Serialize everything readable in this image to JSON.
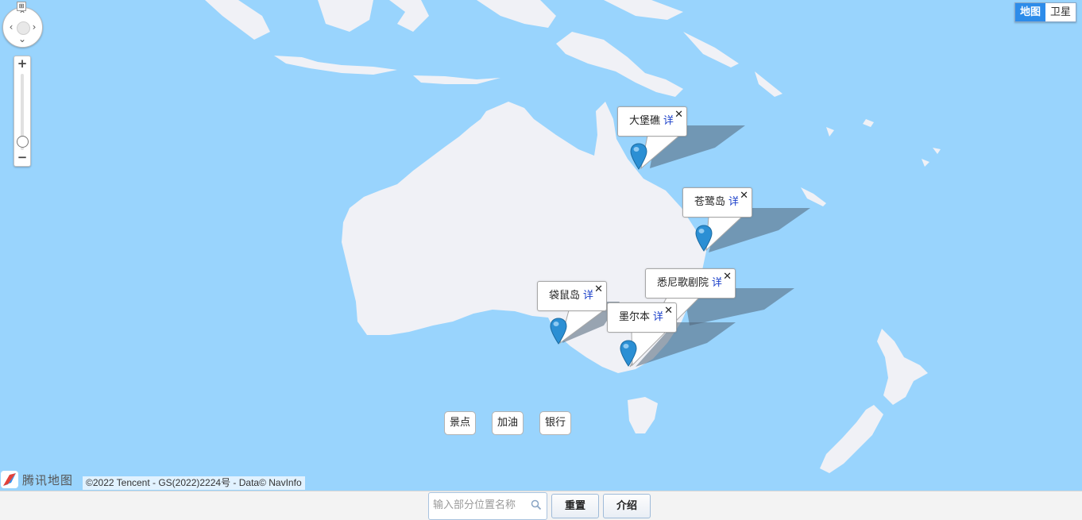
{
  "map": {
    "nav_badge": "⊞",
    "zoom_in_label": "+",
    "zoom_out_label": "−",
    "map_type": {
      "map_label": "地图",
      "satellite_label": "卫星",
      "active": "map"
    },
    "info_windows": [
      {
        "name": "大堡礁",
        "detail": "详",
        "close": "✕"
      },
      {
        "name": "苍鹭岛",
        "detail": "详",
        "close": "✕"
      },
      {
        "name": "悉尼歌剧院",
        "detail": "详",
        "close": "✕"
      },
      {
        "name": "袋鼠岛",
        "detail": "详",
        "close": "✕"
      },
      {
        "name": "墨尔本",
        "detail": "详",
        "close": "✕"
      }
    ],
    "categories": [
      "景点",
      "加油",
      "银行"
    ],
    "logo_text": "腾讯地图",
    "copyright": "©2022 Tencent - GS(2022)2224号 - Data© NavInfo",
    "colors": {
      "water": "#99d4fd",
      "land": "#f0f1f6",
      "marker": "#2b8fd4",
      "accent": "#2d8cea"
    },
    "icons": {
      "marker": "map-pin-icon",
      "search": "search-icon",
      "logo": "tencent-map-logo"
    }
  },
  "toolbar": {
    "search_placeholder": "输入部分位置名称",
    "reset_label": "重置",
    "intro_label": "介绍"
  }
}
